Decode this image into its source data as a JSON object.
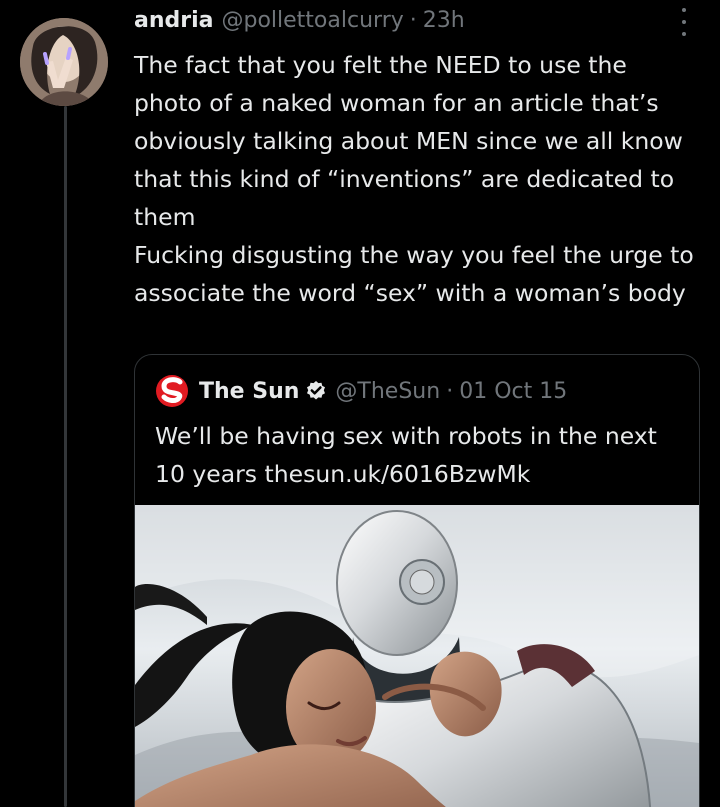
{
  "tweet": {
    "author_name": "andria",
    "author_handle": "@pollettoalcurry",
    "separator": "·",
    "time": "23h",
    "text": "The fact that you felt the NEED to use the photo of a naked woman for an article that’s obviously talking about MEN since we all know that this kind of “inventions” are dedicated to them\nFucking disgusting the way you feel the urge to associate the word “sex” with a woman’s body"
  },
  "quote": {
    "name": "The Sun",
    "handle": "@TheSun",
    "separator": "·",
    "date": "01 Oct 15",
    "text_before_link": "We’ll be having sex with robots in the next 10 years ",
    "link": "thesun.uk/6016BzwMk"
  },
  "icons": {
    "avatar": "avatar",
    "more": "more-icon",
    "logo": "the-sun-logo",
    "verified": "verified-icon"
  },
  "colors": {
    "background": "#000000",
    "text": "#e7e9ea",
    "muted": "#71767b",
    "border": "#2f3336",
    "logo_red": "#e11b22"
  }
}
